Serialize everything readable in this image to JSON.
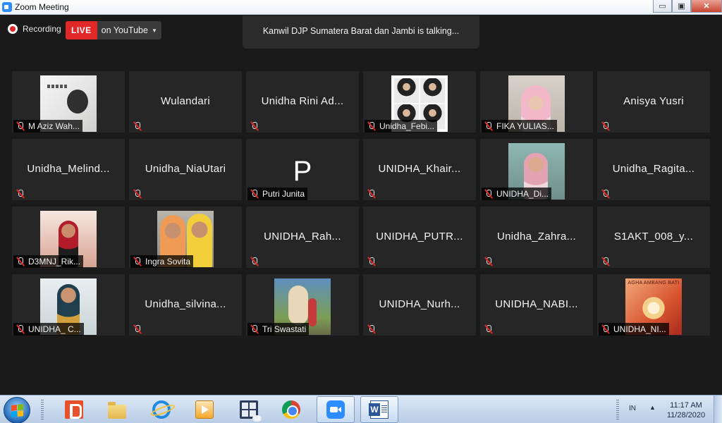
{
  "window": {
    "title": "Zoom Meeting",
    "minimize": "▭",
    "maximize": "▣",
    "close": "✕"
  },
  "recording": {
    "label": "Recording"
  },
  "live": {
    "badge": "LIVE",
    "target": "on YouTube",
    "caret": "▼"
  },
  "talking": {
    "text": "Kanwil DJP Sumatera Barat dan Jambi is talking..."
  },
  "tiles": [
    {
      "name": "M Aziz Wah...",
      "photo": "sketch",
      "center": false
    },
    {
      "name": "Wulandari",
      "center": true
    },
    {
      "name": "Unidha Rini Ad...",
      "center": true
    },
    {
      "name": "Unidha_Febi...",
      "photo": "collage",
      "center": false
    },
    {
      "name": "FIKA YULIAS...",
      "photo": "girl",
      "center": false
    },
    {
      "name": "Anisya Yusri",
      "center": true
    },
    {
      "name": "Unidha_Melind...",
      "center": true
    },
    {
      "name": "Unidha_NiaUtari",
      "center": true
    },
    {
      "name": "Putri Junita",
      "photo": "letter",
      "letter": "P",
      "center": false
    },
    {
      "name": "UNIDHA_Khair...",
      "center": true
    },
    {
      "name": "UNIDHA_Di...",
      "photo": "teal",
      "center": false
    },
    {
      "name": "Unidha_Ragita...",
      "center": true
    },
    {
      "name": "D3MNJ_Rik...",
      "photo": "red",
      "center": false
    },
    {
      "name": "Ingra Sovita",
      "photo": "pair",
      "center": false
    },
    {
      "name": "UNIDHA_Rah...",
      "center": true
    },
    {
      "name": "UNIDHA_PUTR...",
      "center": true
    },
    {
      "name": "Unidha_Zahra...",
      "center": true
    },
    {
      "name": "S1AKT_008_y...",
      "center": true
    },
    {
      "name": "UNIDHA_ C...",
      "photo": "hijab",
      "center": false
    },
    {
      "name": "Unidha_silvina...",
      "center": true
    },
    {
      "name": "Tri Swastati",
      "photo": "statue",
      "center": false
    },
    {
      "name": "UNIDHA_Nurh...",
      "center": true
    },
    {
      "name": "UNIDHA_NABI...",
      "center": true
    },
    {
      "name": "UNIDHA_NI...",
      "photo": "poster",
      "poster_text": "AGHA AMBANG BATI",
      "center": false
    }
  ],
  "taskbar": {
    "buttons": [
      {
        "id": "pdf",
        "icon": "pdf-app-icon"
      },
      {
        "id": "folder",
        "icon": "folder-icon"
      },
      {
        "id": "ie",
        "icon": "internet-explorer-icon"
      },
      {
        "id": "media",
        "icon": "media-player-icon"
      },
      {
        "id": "calc",
        "icon": "calculator-icon",
        "badge": "12"
      },
      {
        "id": "chrome",
        "icon": "chrome-icon"
      },
      {
        "id": "zoom",
        "icon": "zoom-icon",
        "active": true
      },
      {
        "id": "word",
        "icon": "word-icon",
        "active": true
      }
    ],
    "language": "IN",
    "tray_arrow": "▲",
    "time": "11:17 AM",
    "date": "11/28/2020"
  },
  "colors": {
    "live": "#e02828",
    "tile_bg": "#262626",
    "muted_mic": "#e02828"
  }
}
